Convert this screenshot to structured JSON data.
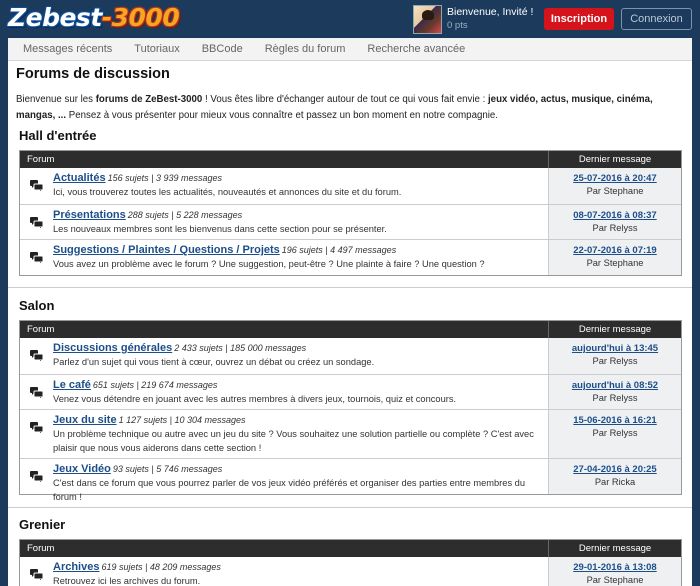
{
  "header": {
    "logo_part1": "Zebest",
    "logo_part2": "-3000",
    "greeting": "Bienvenue, Invité !",
    "points": "0 pts",
    "signup_label": "Inscription",
    "login_label": "Connexion"
  },
  "nav": [
    "Messages récents",
    "Tutoriaux",
    "BBCode",
    "Règles du forum",
    "Recherche avancée"
  ],
  "page": {
    "title": "Forums de discussion",
    "welcome_1": "Bienvenue sur les ",
    "welcome_bold1": "forums de ZeBest-3000",
    "welcome_2": " ! Vous êtes libre d'échanger autour de tout ce qui vous fait envie : ",
    "welcome_bold2": "jeux vidéo, actus, musique, cinéma, mangas, ...",
    "welcome_3": " Pensez à vous présenter pour mieux vous connaître et passez un bon moment en notre compagnie."
  },
  "table_headers": {
    "forum": "Forum",
    "last": "Dernier message"
  },
  "sections": [
    {
      "title": "Hall d'entrée",
      "forums": [
        {
          "name": "Actualités",
          "stats": "156 sujets | 3 939 messages",
          "desc": "Ici, vous trouverez toutes les actualités, nouveautés et annonces du site et du forum.",
          "last_date": "25-07-2016 à 20:47",
          "last_by": "Par Stephane"
        },
        {
          "name": "Présentations",
          "stats": "288 sujets | 5 228 messages",
          "desc": "Les nouveaux membres sont les bienvenus dans cette section pour se présenter.",
          "last_date": "08-07-2016 à 08:37",
          "last_by": "Par Relyss"
        },
        {
          "name": "Suggestions / Plaintes / Questions / Projets",
          "stats": "196 sujets | 4 497 messages",
          "desc": "Vous avez un problème avec le forum ? Une suggestion, peut-être ? Une plainte à faire ? Une question ?",
          "last_date": "22-07-2016 à 07:19",
          "last_by": "Par Stephane"
        }
      ]
    },
    {
      "title": "Salon",
      "forums": [
        {
          "name": "Discussions générales",
          "stats": "2 433 sujets | 185 000 messages",
          "desc": "Parlez d'un sujet qui vous tient à cœur, ouvrez un débat ou créez un sondage.",
          "last_date": "aujourd'hui à 13:45",
          "last_by": "Par Relyss"
        },
        {
          "name": "Le café",
          "stats": "651 sujets | 219 674 messages",
          "desc": "Venez vous détendre en jouant avec les autres membres à divers jeux, tournois, quiz et concours.",
          "last_date": "aujourd'hui à 08:52",
          "last_by": "Par Relyss"
        },
        {
          "name": "Jeux du site",
          "stats": "1 127 sujets | 10 304 messages",
          "desc": "Un problème technique ou autre avec un jeu du site ? Vous souhaitez une solution partielle ou complète ? C'est avec plaisir que nous vous aiderons dans cette section !",
          "last_date": "15-06-2016 à 16:21",
          "last_by": "Par Relyss"
        },
        {
          "name": "Jeux Vidéo",
          "stats": "93 sujets | 5 746 messages",
          "desc": "C'est dans ce forum que vous pourrez parler de vos jeux vidéo préférés et organiser des parties entre membres du forum !",
          "last_date": "27-04-2016 à 20:25",
          "last_by": "Par Ricka"
        }
      ]
    },
    {
      "title": "Grenier",
      "forums": [
        {
          "name": "Archives",
          "stats": "619 sujets | 48 209 messages",
          "desc": "Retrouvez ici les archives du forum.",
          "last_date": "29-01-2016 à 13:08",
          "last_by": "Par Stephane"
        }
      ]
    }
  ]
}
